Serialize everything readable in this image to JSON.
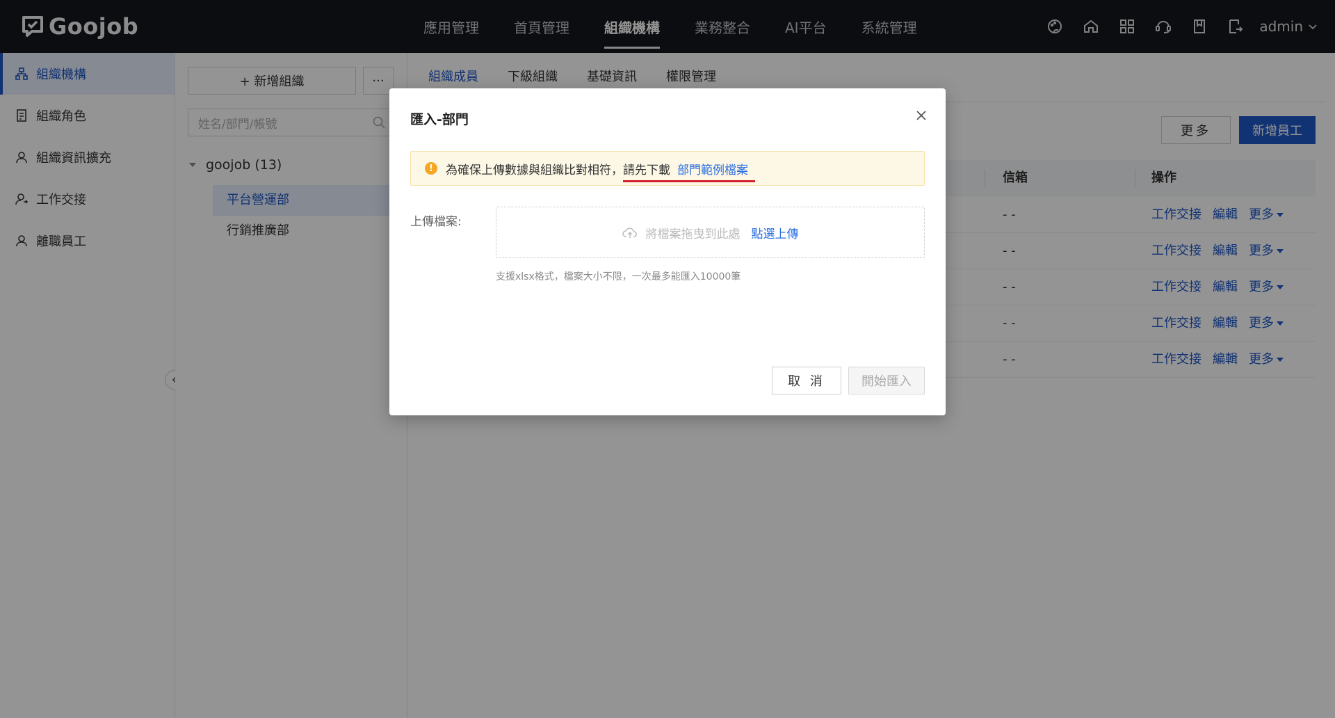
{
  "brand": {
    "logo_text": "Goojob"
  },
  "topnav": {
    "items": [
      "應用管理",
      "首頁管理",
      "組織機構",
      "業務整合",
      "AI平台",
      "系統管理"
    ],
    "active": "組織機構"
  },
  "user": {
    "name": "admin"
  },
  "sidebar": {
    "items": [
      {
        "label": "組織機構",
        "icon": "org-icon",
        "active": true
      },
      {
        "label": "組織角色",
        "icon": "role-icon"
      },
      {
        "label": "組織資訊擴充",
        "icon": "user-icon"
      },
      {
        "label": "工作交接",
        "icon": "handover-icon"
      },
      {
        "label": "離職員工",
        "icon": "user-icon"
      }
    ]
  },
  "tree": {
    "add_button": "+ 新增組織",
    "more_button": "···",
    "search_placeholder": "姓名/部門/帳號",
    "root": "goojob (13)",
    "nodes": [
      "平台營運部",
      "行銷推廣部"
    ]
  },
  "main": {
    "tabs": [
      "組織成員",
      "下級組織",
      "基礎資訊",
      "權限管理"
    ],
    "more_button": "更多",
    "add_button": "新增員工",
    "columns": {
      "email": "信箱",
      "actions": "操作"
    },
    "rows": [
      {
        "email": "- -",
        "handover": "工作交接",
        "edit": "編輯",
        "more": "更多"
      },
      {
        "email": "- -",
        "handover": "工作交接",
        "edit": "編輯",
        "more": "更多"
      },
      {
        "email": "- -",
        "handover": "工作交接",
        "edit": "編輯",
        "more": "更多"
      },
      {
        "email": "- -",
        "handover": "工作交接",
        "edit": "編輯",
        "more": "更多"
      },
      {
        "email": "- -",
        "handover": "工作交接",
        "edit": "編輯",
        "more": "更多"
      }
    ]
  },
  "modal": {
    "title": "匯入-部門",
    "alert_text": "為確保上傳數據與組織比對相符，",
    "alert_download": "請先下載",
    "alert_template_link": "部門範例檔案",
    "upload_label": "上傳檔案:",
    "drop_text": "將檔案拖曳到此處",
    "pick_text": "點選上傳",
    "hint": "支援xlsx格式，檔案大小不限，一次最多能匯入10000筆",
    "cancel_button": "取 消",
    "start_button": "開始匯入"
  },
  "colors": {
    "primary": "#1e56c6",
    "link": "#2a6ee0",
    "topbar": "#16181c",
    "warning": "#f5a623",
    "annotation": "#d4202a"
  }
}
